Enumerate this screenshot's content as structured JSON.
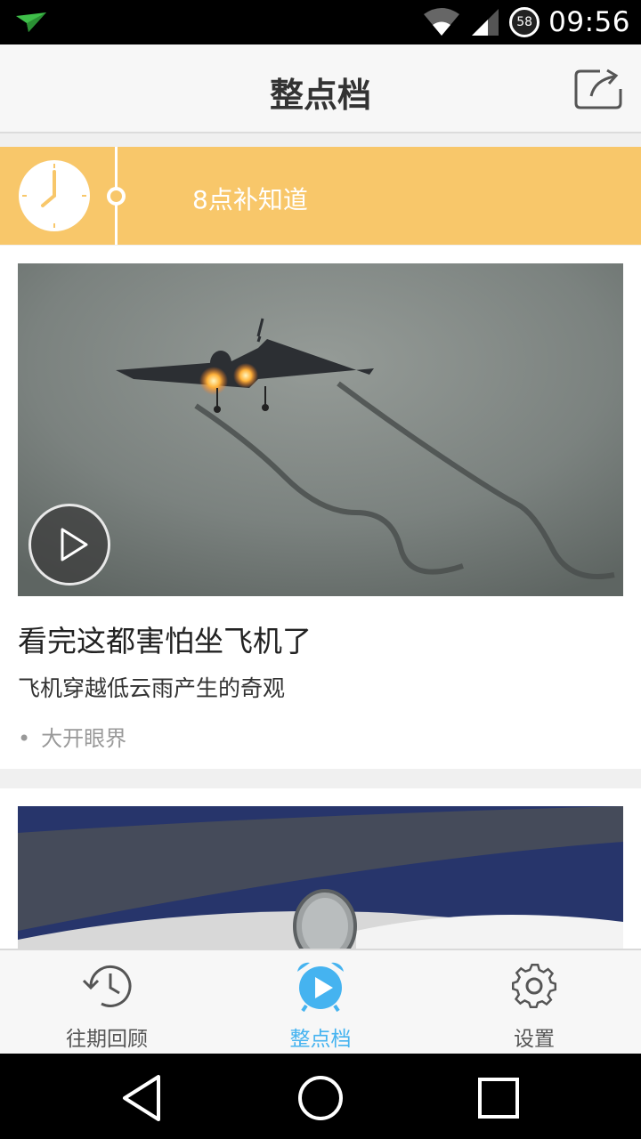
{
  "status_bar": {
    "time": "09:56",
    "battery_level": "58",
    "notification_icon": "paper-plane-icon",
    "wifi_icon": "wifi-icon",
    "signal_icon": "signal-icon"
  },
  "header": {
    "title": "整点档",
    "share_icon": "share-icon"
  },
  "timeline": {
    "label": "8点补知道",
    "clock_icon": "clock-icon",
    "accent_color": "#f8c76a"
  },
  "feed": [
    {
      "headline": "看完这都害怕坐飞机了",
      "subtitle": "飞机穿越低云雨产生的奇观",
      "tag": "大开眼界",
      "bullet": "•",
      "play_icon": "play-icon"
    }
  ],
  "bottom_nav": {
    "items": [
      {
        "label": "往期回顾",
        "icon": "history-icon",
        "active": false
      },
      {
        "label": "整点档",
        "icon": "alarm-clock-play-icon",
        "active": true
      },
      {
        "label": "设置",
        "icon": "gear-icon",
        "active": false
      }
    ],
    "active_color": "#45b3f0"
  },
  "system_nav": {
    "back_icon": "back-triangle-icon",
    "home_icon": "home-circle-icon",
    "recents_icon": "recents-square-icon"
  }
}
